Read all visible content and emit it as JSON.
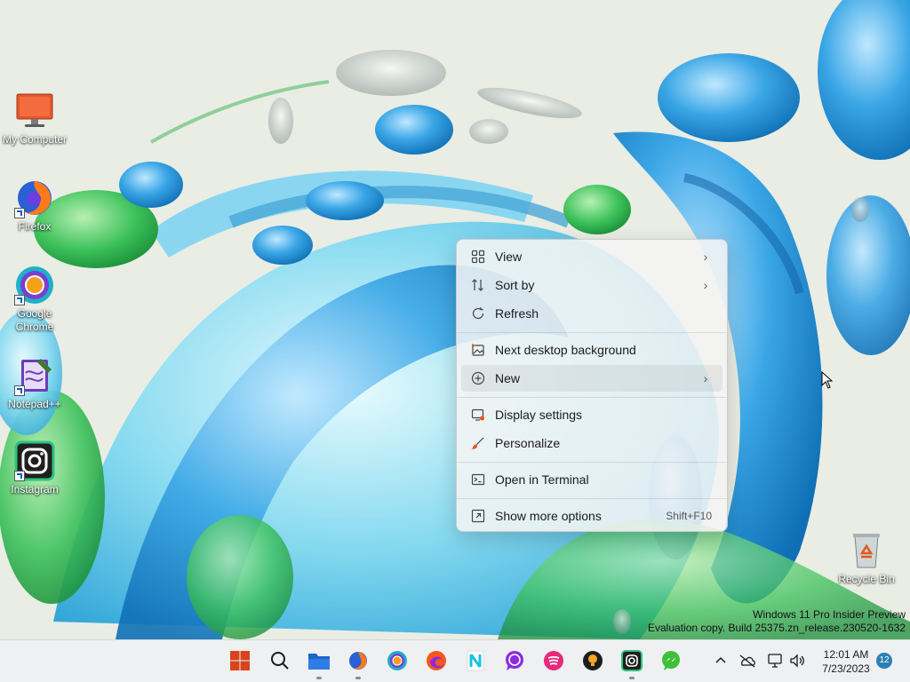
{
  "desktop_icons": [
    {
      "label": "My Computer",
      "icon": "monitor-icon",
      "shortcut": false
    },
    {
      "label": "Firefox",
      "icon": "firefox-icon",
      "shortcut": true
    },
    {
      "label": "Google Chrome",
      "icon": "chrome-icon",
      "shortcut": true
    },
    {
      "label": "Notepad++",
      "icon": "notepadpp-icon",
      "shortcut": true
    },
    {
      "label": "Instagram",
      "icon": "instagram-icon",
      "shortcut": true
    },
    {
      "label": "Recycle Bin",
      "icon": "recycle-bin-icon",
      "shortcut": false
    }
  ],
  "context_menu": {
    "items": [
      {
        "label": "View",
        "icon": "view-grid-icon",
        "submenu": true
      },
      {
        "label": "Sort by",
        "icon": "sort-icon",
        "submenu": true
      },
      {
        "label": "Refresh",
        "icon": "refresh-icon",
        "submenu": false
      },
      {
        "label": "Next desktop background",
        "icon": "next-background-icon",
        "submenu": false
      },
      {
        "label": "New",
        "icon": "new-plus-icon",
        "submenu": true,
        "highlighted": true
      },
      {
        "label": "Display settings",
        "icon": "display-settings-icon",
        "submenu": false
      },
      {
        "label": "Personalize",
        "icon": "personalize-brush-icon",
        "submenu": false
      },
      {
        "label": "Open in Terminal",
        "icon": "terminal-icon",
        "submenu": false
      },
      {
        "label": "Show more options",
        "icon": "show-more-icon",
        "submenu": false,
        "shortcut": "Shift+F10"
      }
    ]
  },
  "watermark": {
    "line1": "Windows 11 Pro Insider Preview",
    "line2": "Evaluation copy. Build 25375.zn_release.230520-1632"
  },
  "taskbar": {
    "apps": [
      "start-icon",
      "search-icon",
      "file-explorer-icon",
      "firefox-icon",
      "chrome-icon",
      "edge-icon",
      "notion-icon",
      "whatsapp-icon",
      "spotify-icon",
      "bulb-app-icon",
      "instagram-icon",
      "messenger-icon"
    ],
    "time": "12:01 AM",
    "date": "7/23/2023",
    "notification_count": "12"
  },
  "colors": {
    "menu_bg": "#f4f4f4",
    "accent": "#2b7fb8",
    "taskbar_bg": "#eef0f1"
  }
}
